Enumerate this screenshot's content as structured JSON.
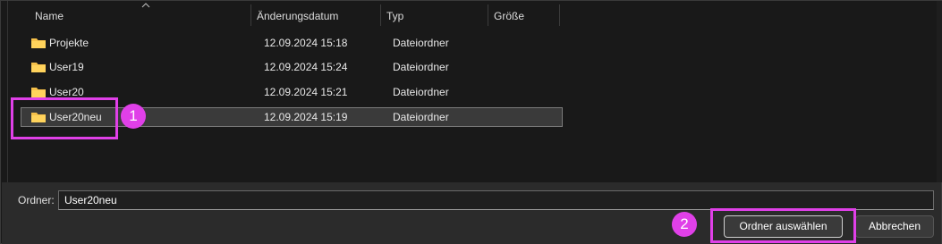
{
  "columns": {
    "name": "Name",
    "date": "Änderungsdatum",
    "type": "Typ",
    "size": "Größe"
  },
  "rows": [
    {
      "name": "Projekte",
      "date": "12.09.2024 15:18",
      "type": "Dateiordner",
      "size": ""
    },
    {
      "name": "User19",
      "date": "12.09.2024 15:24",
      "type": "Dateiordner",
      "size": ""
    },
    {
      "name": "User20",
      "date": "12.09.2024 15:21",
      "type": "Dateiordner",
      "size": ""
    },
    {
      "name": "User20neu",
      "date": "12.09.2024 15:19",
      "type": "Dateiordner",
      "size": "",
      "selected": true
    }
  ],
  "folder_field": {
    "label": "Ordner:",
    "value": "User20neu"
  },
  "buttons": {
    "select_folder": "Ordner auswählen",
    "cancel": "Abbrechen"
  },
  "annotations": {
    "step1": "1",
    "step2": "2"
  },
  "colors": {
    "highlight": "#e040e8",
    "folder": "#f5c04a",
    "background": "#191919"
  }
}
